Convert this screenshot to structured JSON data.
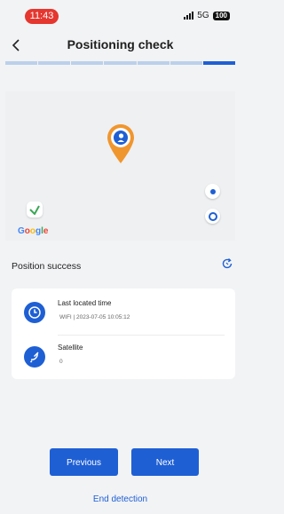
{
  "status_bar": {
    "time": "11:43",
    "network": "5G",
    "battery": "100"
  },
  "header": {
    "title": "Positioning check"
  },
  "progress": {
    "segments": 7,
    "current": 7
  },
  "map": {
    "provider_logo": "Google"
  },
  "position": {
    "status_text": "Position success"
  },
  "card": {
    "last_located": {
      "label": "Last located time",
      "value": "WIFI | 2023-07-05 10:05:12"
    },
    "satellite": {
      "label": "Satellite",
      "value": "0"
    }
  },
  "buttons": {
    "previous": "Previous",
    "next": "Next"
  },
  "end_link": "End detection",
  "colors": {
    "accent": "#1e5fd4",
    "pin": "#f0962e",
    "time_pill": "#e5372f"
  }
}
